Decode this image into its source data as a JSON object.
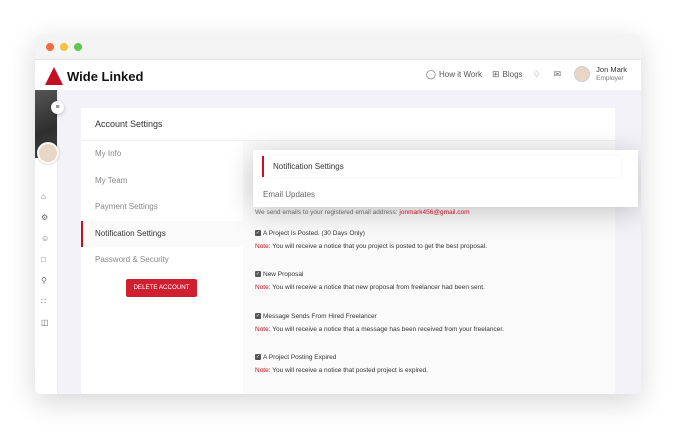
{
  "app": {
    "brand": "Wide Linked"
  },
  "header": {
    "links": [
      {
        "label": "How it Work",
        "icon": "lightbulb-icon"
      },
      {
        "label": "Blogs",
        "icon": "grid-icon"
      }
    ],
    "user": {
      "name": "Jon Mark",
      "role": "Employer"
    }
  },
  "card": {
    "title": "Account Settings"
  },
  "settings_nav": [
    "My Info",
    "My Team",
    "Payment Settings",
    "Notification Settings",
    "Password & Security"
  ],
  "delete_button": "DELETE ACCOUNT",
  "notification": {
    "title": "Notification Settings",
    "subtitle": "Email Updates",
    "intro": "We send emails to your registered email address:",
    "email": "jonmark456@gmail.com",
    "note_label": "Note:",
    "items": [
      {
        "label": "A Project Is Posted. (30 Days Only)",
        "note": "You will receive a notice that you project is posted to get the best proposal."
      },
      {
        "label": "New Proposal",
        "note": "You will receive a notice that new proposal from freelancer had been sent."
      },
      {
        "label": "Message Sends From Hired Freelancer",
        "note": "You will receive a notice that a message has been received from your freelancer."
      },
      {
        "label": "A Project Posting Expired",
        "note": "You will receive a notice that posted project is expired."
      }
    ]
  }
}
